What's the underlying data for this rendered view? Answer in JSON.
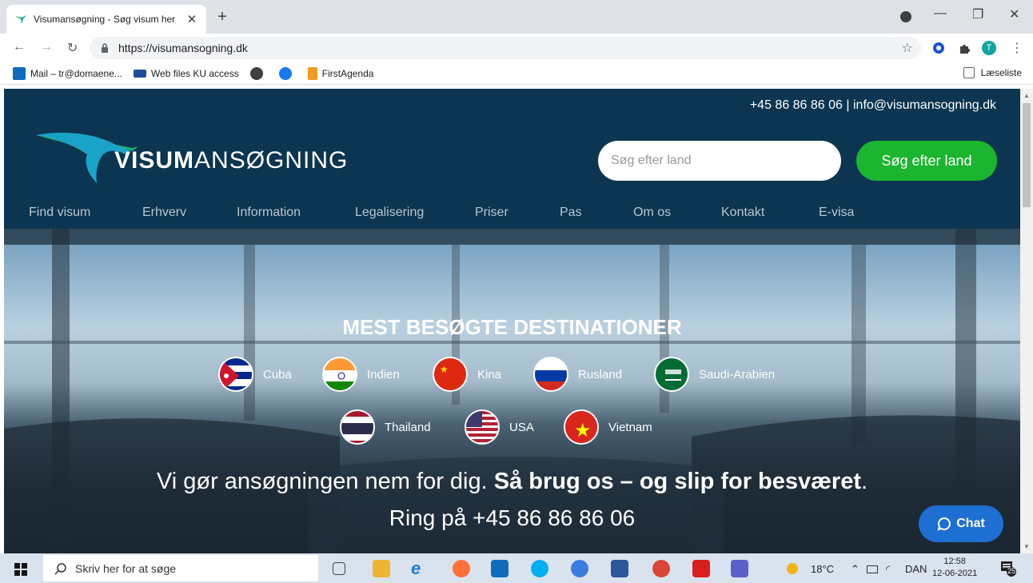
{
  "browser": {
    "tab_title": "Visumansøgning - Søg visum her",
    "tab_close": "✕",
    "new_tab": "+",
    "url": "https://visumansogning.dk",
    "bookmarks": [
      {
        "label": "Mail – tr@domaene..."
      },
      {
        "label": "Web files KU access"
      },
      {
        "label": ""
      },
      {
        "label": ""
      },
      {
        "label": "FirstAgenda"
      }
    ],
    "reading_list": "Læseliste",
    "profile_initial": "T"
  },
  "site": {
    "contact": "+45 86 86 86 06 | info@visumansogning.dk",
    "logo_bold": "VISUM",
    "logo_light": "ANSØGNING",
    "search_placeholder": "Søg efter land",
    "search_button": "Søg efter land",
    "nav": [
      "Find visum",
      "Erhverv",
      "Information",
      "Legalisering",
      "Priser",
      "Pas",
      "Om os",
      "Kontakt",
      "E-visa"
    ],
    "hero_title": "MEST BESØGTE DESTINATIONER",
    "destinations": [
      "Cuba",
      "Indien",
      "Kina",
      "Rusland",
      "Saudi-Arabien",
      "Thailand",
      "USA",
      "Vietnam"
    ],
    "tagline_light": "Vi gør ansøgningen nem for dig. ",
    "tagline_bold": "Så brug os – og slip for besværet",
    "tagline_end": ".",
    "ring": "Ring på +45 86 86 86 06",
    "chat": "Chat"
  },
  "taskbar": {
    "search_placeholder": "Skriv her for at søge",
    "weather": "18°C",
    "language": "DAN",
    "time": "12:58",
    "date": "12-06-2021",
    "notifications": "25"
  },
  "colors": {
    "header_bg": "#0b3550",
    "search_button": "#1bb52f",
    "chat_button": "#1d6fd1"
  }
}
